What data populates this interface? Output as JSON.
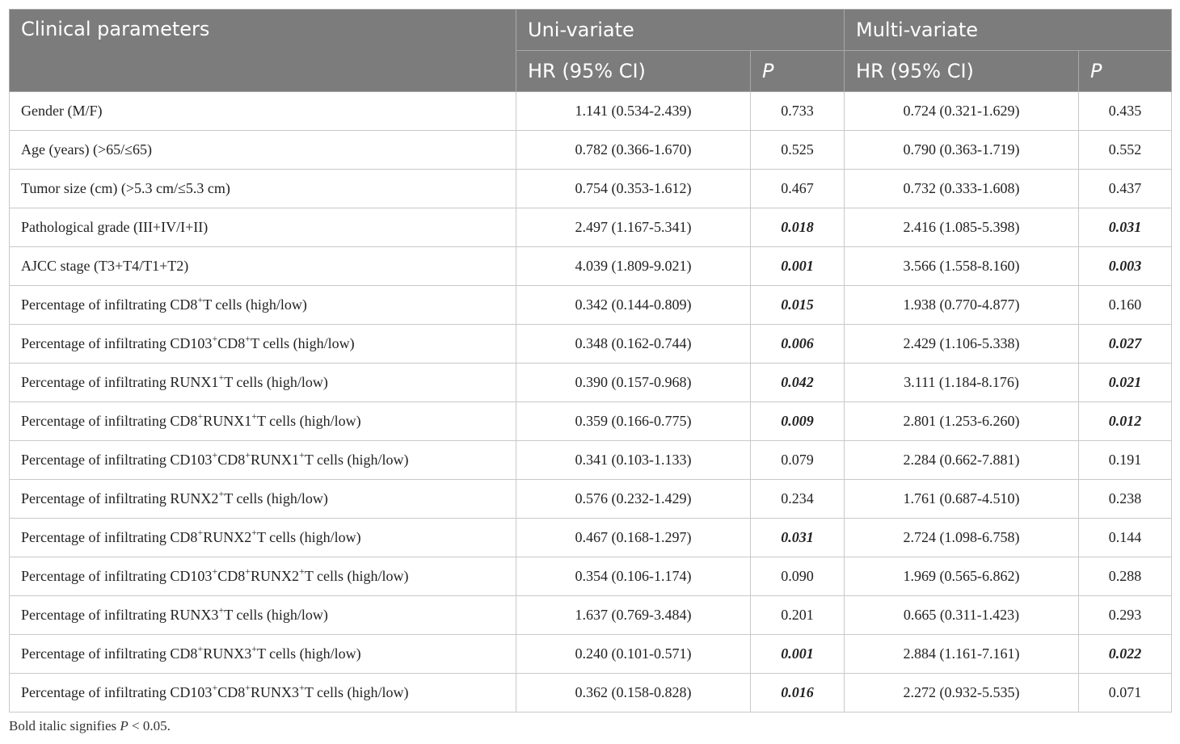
{
  "header": {
    "clinical_parameters": "Clinical parameters",
    "uni_variate": "Uni-variate",
    "multi_variate": "Multi-variate",
    "hr_ci": "HR (95% CI)",
    "p": "P"
  },
  "rows": [
    {
      "param": "Gender (M/F)",
      "uni_hr": "1.141 (0.534-2.439)",
      "uni_p": "0.733",
      "uni_sig": false,
      "multi_hr": "0.724 (0.321-1.629)",
      "multi_p": "0.435",
      "multi_sig": false
    },
    {
      "param": "Age (years) (>65/≤65)",
      "uni_hr": "0.782 (0.366-1.670)",
      "uni_p": "0.525",
      "uni_sig": false,
      "multi_hr": "0.790 (0.363-1.719)",
      "multi_p": "0.552",
      "multi_sig": false
    },
    {
      "param": "Tumor size (cm) (>5.3 cm/≤5.3 cm)",
      "uni_hr": "0.754 (0.353-1.612)",
      "uni_p": "0.467",
      "uni_sig": false,
      "multi_hr": "0.732 (0.333-1.608)",
      "multi_p": "0.437",
      "multi_sig": false
    },
    {
      "param": "Pathological grade (III+IV/I+II)",
      "uni_hr": "2.497 (1.167-5.341)",
      "uni_p": "0.018",
      "uni_sig": true,
      "multi_hr": "2.416 (1.085-5.398)",
      "multi_p": "0.031",
      "multi_sig": true
    },
    {
      "param": "AJCC stage (T3+T4/T1+T2)",
      "uni_hr": "4.039 (1.809-9.021)",
      "uni_p": "0.001",
      "uni_sig": true,
      "multi_hr": "3.566 (1.558-8.160)",
      "multi_p": "0.003",
      "multi_sig": true
    },
    {
      "param": "Percentage of infiltrating CD8<sup>+</sup>T cells (high/low)",
      "uni_hr": "0.342 (0.144-0.809)",
      "uni_p": "0.015",
      "uni_sig": true,
      "multi_hr": "1.938 (0.770-4.877)",
      "multi_p": "0.160",
      "multi_sig": false
    },
    {
      "param": "Percentage of infiltrating CD103<sup>+</sup>CD8<sup>+</sup>T cells (high/low)",
      "uni_hr": "0.348 (0.162-0.744)",
      "uni_p": "0.006",
      "uni_sig": true,
      "multi_hr": "2.429 (1.106-5.338)",
      "multi_p": "0.027",
      "multi_sig": true
    },
    {
      "param": "Percentage of infiltrating RUNX1<sup>+</sup>T cells (high/low)",
      "uni_hr": "0.390 (0.157-0.968)",
      "uni_p": "0.042",
      "uni_sig": true,
      "multi_hr": "3.111 (1.184-8.176)",
      "multi_p": "0.021",
      "multi_sig": true
    },
    {
      "param": "Percentage of infiltrating CD8<sup>+</sup>RUNX1<sup>+</sup>T cells (high/low)",
      "uni_hr": "0.359 (0.166-0.775)",
      "uni_p": "0.009",
      "uni_sig": true,
      "multi_hr": "2.801 (1.253-6.260)",
      "multi_p": "0.012",
      "multi_sig": true
    },
    {
      "param": "Percentage of infiltrating CD103<sup>+</sup>CD8<sup>+</sup>RUNX1<sup>+</sup>T cells (high/low)",
      "uni_hr": "0.341 (0.103-1.133)",
      "uni_p": "0.079",
      "uni_sig": false,
      "multi_hr": "2.284 (0.662-7.881)",
      "multi_p": "0.191",
      "multi_sig": false
    },
    {
      "param": "Percentage of infiltrating RUNX2<sup>+</sup>T cells (high/low)",
      "uni_hr": "0.576 (0.232-1.429)",
      "uni_p": "0.234",
      "uni_sig": false,
      "multi_hr": "1.761 (0.687-4.510)",
      "multi_p": "0.238",
      "multi_sig": false
    },
    {
      "param": "Percentage of infiltrating CD8<sup>+</sup>RUNX2<sup>+</sup>T cells (high/low)",
      "uni_hr": "0.467 (0.168-1.297)",
      "uni_p": "0.031",
      "uni_sig": true,
      "multi_hr": "2.724 (1.098-6.758)",
      "multi_p": "0.144",
      "multi_sig": false
    },
    {
      "param": "Percentage of infiltrating CD103<sup>+</sup>CD8<sup>+</sup>RUNX2<sup>+</sup>T cells (high/low)",
      "uni_hr": "0.354 (0.106-1.174)",
      "uni_p": "0.090",
      "uni_sig": false,
      "multi_hr": "1.969 (0.565-6.862)",
      "multi_p": "0.288",
      "multi_sig": false
    },
    {
      "param": "Percentage of infiltrating RUNX3<sup>+</sup>T cells (high/low)",
      "uni_hr": "1.637 (0.769-3.484)",
      "uni_p": "0.201",
      "uni_sig": false,
      "multi_hr": "0.665 (0.311-1.423)",
      "multi_p": "0.293",
      "multi_sig": false
    },
    {
      "param": "Percentage of infiltrating CD8<sup>+</sup>RUNX3<sup>+</sup>T cells (high/low)",
      "uni_hr": "0.240 (0.101-0.571)",
      "uni_p": "0.001",
      "uni_sig": true,
      "multi_hr": "2.884 (1.161-7.161)",
      "multi_p": "0.022",
      "multi_sig": true
    },
    {
      "param": "Percentage of infiltrating CD103<sup>+</sup>CD8<sup>+</sup>RUNX3<sup>+</sup>T cells (high/low)",
      "uni_hr": "0.362 (0.158-0.828)",
      "uni_p": "0.016",
      "uni_sig": true,
      "multi_hr": "2.272 (0.932-5.535)",
      "multi_p": "0.071",
      "multi_sig": false
    }
  ],
  "footnote": {
    "prefix": "Bold italic signifies ",
    "p": "P",
    "suffix": " < 0.05."
  }
}
